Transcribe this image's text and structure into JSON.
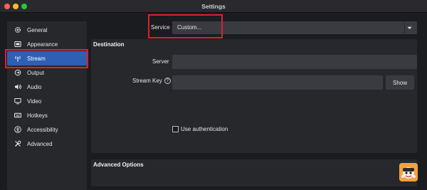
{
  "window": {
    "title": "Settings"
  },
  "sidebar": {
    "items": [
      {
        "label": "General",
        "icon": "gear-icon"
      },
      {
        "label": "Appearance",
        "icon": "appearance-icon"
      },
      {
        "label": "Stream",
        "icon": "antenna-icon",
        "active": true
      },
      {
        "label": "Output",
        "icon": "output-icon"
      },
      {
        "label": "Audio",
        "icon": "speaker-icon"
      },
      {
        "label": "Video",
        "icon": "monitor-icon"
      },
      {
        "label": "Hotkeys",
        "icon": "keyboard-icon"
      },
      {
        "label": "Accessibility",
        "icon": "accessibility-icon"
      },
      {
        "label": "Advanced",
        "icon": "tools-icon"
      }
    ]
  },
  "service": {
    "label": "Service",
    "value": "Custom..."
  },
  "destination": {
    "title": "Destination",
    "server_label": "Server",
    "server_value": "",
    "stream_key_label": "Stream Key",
    "stream_key_value": "",
    "show_label": "Show",
    "use_auth_label": "Use authentication"
  },
  "advanced": {
    "title": "Advanced Options"
  },
  "colors": {
    "active": "#2f5fb5",
    "highlight": "#e01e2b"
  }
}
